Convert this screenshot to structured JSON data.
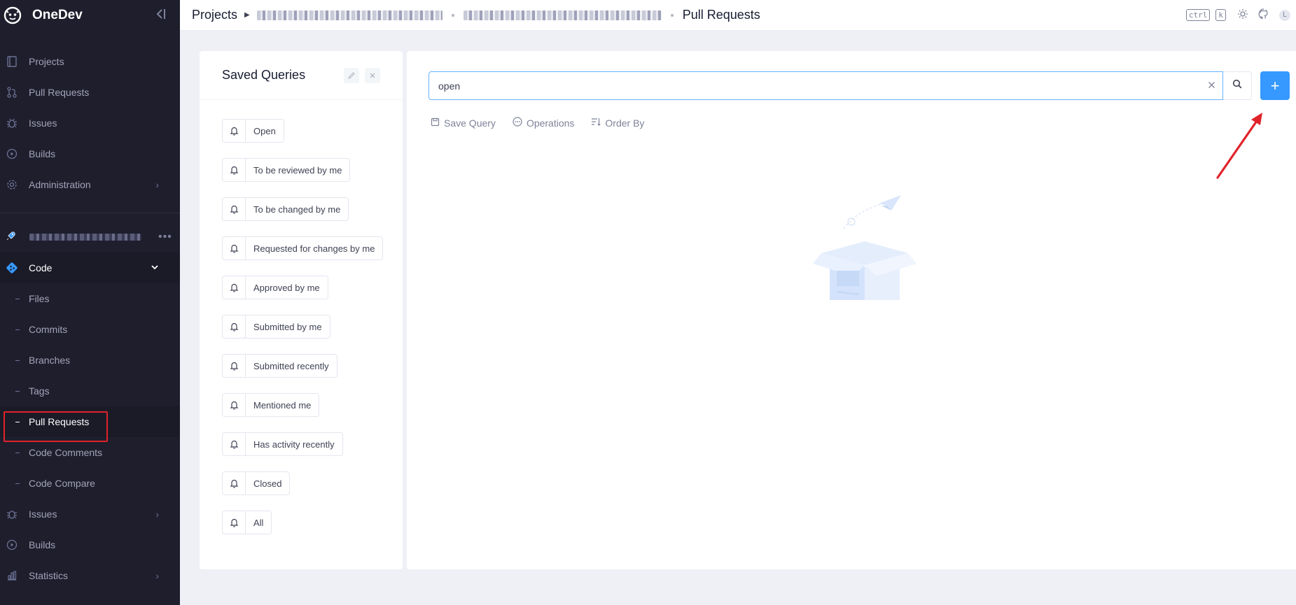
{
  "app": {
    "name": "OneDev"
  },
  "sidebar": {
    "top_items": [
      {
        "label": "Projects",
        "icon": "book-icon"
      },
      {
        "label": "Pull Requests",
        "icon": "pull-request-icon"
      },
      {
        "label": "Issues",
        "icon": "bug-icon"
      },
      {
        "label": "Builds",
        "icon": "play-circle-icon"
      },
      {
        "label": "Administration",
        "icon": "gear-icon"
      }
    ],
    "code_label": "Code",
    "code_sub_items": [
      "Files",
      "Commits",
      "Branches",
      "Tags",
      "Pull Requests",
      "Code Comments",
      "Code Compare"
    ],
    "bottom_items": [
      {
        "label": "Issues",
        "icon": "bug-icon"
      },
      {
        "label": "Builds",
        "icon": "play-circle-icon"
      },
      {
        "label": "Statistics",
        "icon": "bar-chart-icon"
      }
    ]
  },
  "topbar": {
    "projects_link": "Projects",
    "page_title": "Pull Requests",
    "kbd_ctrl": "ctrl",
    "kbd_k": "k",
    "avatar_letter": "L"
  },
  "saved_queries": {
    "title": "Saved Queries",
    "items": [
      "Open",
      "To be reviewed by me",
      "To be changed by me",
      "Requested for changes by me",
      "Approved by me",
      "Submitted by me",
      "Submitted recently",
      "Mentioned me",
      "Has activity recently",
      "Closed",
      "All"
    ]
  },
  "main": {
    "search_value": "open",
    "save_query": "Save Query",
    "operations": "Operations",
    "order_by": "Order By",
    "add_button": "+"
  },
  "colors": {
    "sidebar_bg": "#1e1e2d",
    "accent": "#3699ff",
    "annotation": "#e0232a"
  }
}
